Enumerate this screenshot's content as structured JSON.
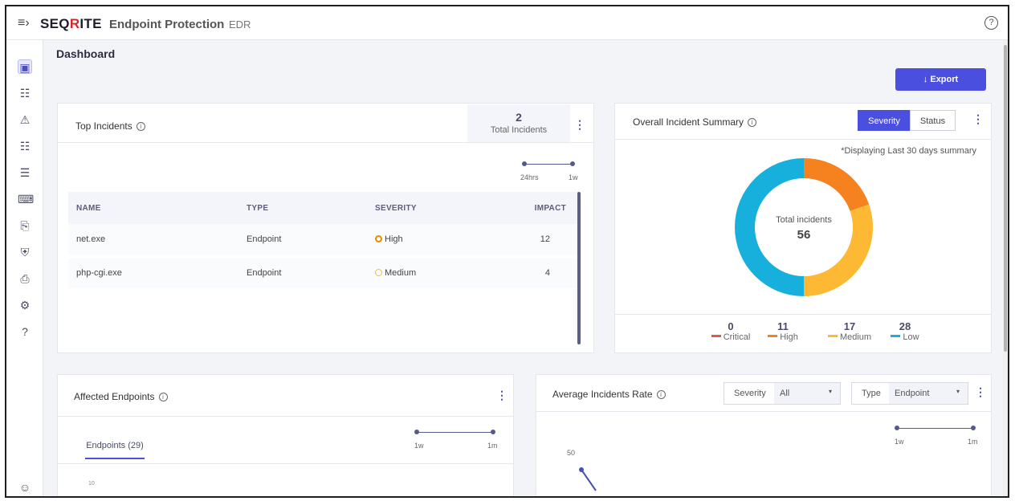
{
  "header": {
    "menu_icon": "menu-collapse-icon",
    "brand_left": "SEQ",
    "brand_r": "R",
    "brand_right": "ITE",
    "product": "Endpoint Protection",
    "module": "EDR",
    "help_icon": "help-circle-icon",
    "help_glyph": "?"
  },
  "sidebar": {
    "items": [
      {
        "name": "dashboard",
        "icon": "bar-chart-icon",
        "glyph": "▣"
      },
      {
        "name": "incidents",
        "icon": "list-icon",
        "glyph": "☷"
      },
      {
        "name": "alerts",
        "icon": "warning-icon",
        "glyph": "⚠"
      },
      {
        "name": "endpoints",
        "icon": "grid-icon",
        "glyph": "☷"
      },
      {
        "name": "filters",
        "icon": "filter-list-icon",
        "glyph": "☰"
      },
      {
        "name": "console",
        "icon": "terminal-icon",
        "glyph": "⌨"
      },
      {
        "name": "files",
        "icon": "file-search-icon",
        "glyph": "⎘"
      },
      {
        "name": "policies",
        "icon": "shield-icon",
        "glyph": "⛨"
      },
      {
        "name": "reports",
        "icon": "document-icon",
        "glyph": "⎙"
      },
      {
        "name": "settings",
        "icon": "gear-icon",
        "glyph": "⚙"
      },
      {
        "name": "help",
        "icon": "question-icon",
        "glyph": "?"
      }
    ],
    "user_icon": "user-circle-icon",
    "user_glyph": "☺"
  },
  "page": {
    "title": "Dashboard",
    "export_label": "↓ Export"
  },
  "top_incidents": {
    "title": "Top Incidents",
    "total_count": "2",
    "total_label": "Total Incidents",
    "range_labels": [
      "24hrs",
      "1w"
    ],
    "columns": [
      "NAME",
      "TYPE",
      "SEVERITY",
      "IMPACT"
    ],
    "rows": [
      {
        "name": "net.exe",
        "type": "Endpoint",
        "severity": "High",
        "impact": "12",
        "color": "#e68a00"
      },
      {
        "name": "php-cgi.exe",
        "type": "Endpoint",
        "severity": "Medium",
        "impact": "4",
        "color": "#f5b942"
      }
    ]
  },
  "summary": {
    "title": "Overall Incident Summary",
    "tabs": [
      "Severity",
      "Status"
    ],
    "active_tab": "Severity",
    "note": "*Displaying Last 30 days summary",
    "center_label": "Total incidents",
    "center_value": "56",
    "legend": [
      {
        "label": "Critical",
        "value": "0",
        "color": "#e05a4a"
      },
      {
        "label": "High",
        "value": "11",
        "color": "#f5821f"
      },
      {
        "label": "Medium",
        "value": "17",
        "color": "#fdb933"
      },
      {
        "label": "Low",
        "value": "28",
        "color": "#17b0dc"
      }
    ]
  },
  "affected": {
    "title": "Affected Endpoints",
    "range_labels": [
      "1w",
      "1m"
    ],
    "tab": "Endpoints (29)",
    "axis_top": "10"
  },
  "avg_rate": {
    "title": "Average Incidents Rate",
    "severity_label": "Severity",
    "severity_value": "All",
    "type_label": "Type",
    "type_value": "Endpoint",
    "range_labels": [
      "1w",
      "1m"
    ],
    "axis_top": "50"
  },
  "chart_data": {
    "type": "pie",
    "title": "Overall Incident Summary",
    "categories": [
      "Critical",
      "High",
      "Medium",
      "Low"
    ],
    "values": [
      0,
      11,
      17,
      28
    ],
    "colors": [
      "#e05a4a",
      "#f5821f",
      "#fdb933",
      "#17b0dc"
    ]
  }
}
